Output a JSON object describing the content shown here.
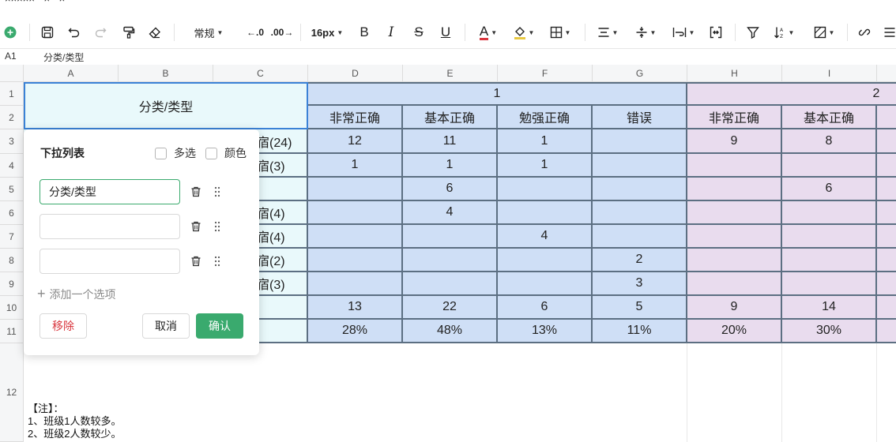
{
  "title_strip": "××××× · × · ×",
  "toolbar": {
    "number_format": "常规",
    "font_size": "16px"
  },
  "formula_bar": {
    "cell_ref": "A1",
    "content": "分类/类型"
  },
  "grid": {
    "columns": [
      "A",
      "B",
      "C",
      "D",
      "E",
      "F",
      "G",
      "H",
      "I"
    ],
    "rows": [
      "1",
      "2",
      "3",
      "4",
      "5",
      "6",
      "7",
      "8",
      "9",
      "10",
      "11",
      "12"
    ],
    "header_cell": "分类/类型",
    "group_1": "1",
    "group_2": "2",
    "sub_headers": [
      "非常正确",
      "基本正确",
      "勉强正确",
      "错误",
      "非常正确",
      "基本正确"
    ],
    "row_labels": [
      "宿(24)",
      "宿(3)",
      "",
      "宿(4)",
      "宿(4)",
      "宿(2)",
      "宿(3)",
      "",
      ""
    ],
    "body": [
      [
        "12",
        "11",
        "1",
        "",
        "9",
        "8"
      ],
      [
        "1",
        "1",
        "1",
        "",
        "",
        ""
      ],
      [
        "",
        "6",
        "",
        "",
        "",
        "6"
      ],
      [
        "",
        "4",
        "",
        "",
        "",
        ""
      ],
      [
        "",
        "",
        "4",
        "",
        "",
        ""
      ],
      [
        "",
        "",
        "",
        "2",
        "",
        ""
      ],
      [
        "",
        "",
        "",
        "3",
        "",
        ""
      ],
      [
        "13",
        "22",
        "6",
        "5",
        "9",
        "14"
      ],
      [
        "28%",
        "48%",
        "13%",
        "11%",
        "20%",
        "30%"
      ]
    ],
    "note": [
      "【注】：",
      "1、班级1人数较多。",
      "2、班级2人数较少。"
    ]
  },
  "popup": {
    "title": "下拉列表",
    "multi_select_label": "多选",
    "color_label": "颜色",
    "options": [
      "分类/类型",
      "",
      ""
    ],
    "add_option_label": "添加一个选项",
    "remove_label": "移除",
    "cancel_label": "取消",
    "confirm_label": "确认"
  },
  "colors": {
    "accent": "#3aaa6e",
    "cyan_fill": "#e9f9fb",
    "blue_fill": "#cfdff6",
    "pink_fill": "#e9dcee",
    "remove_red": "#d9363e"
  }
}
